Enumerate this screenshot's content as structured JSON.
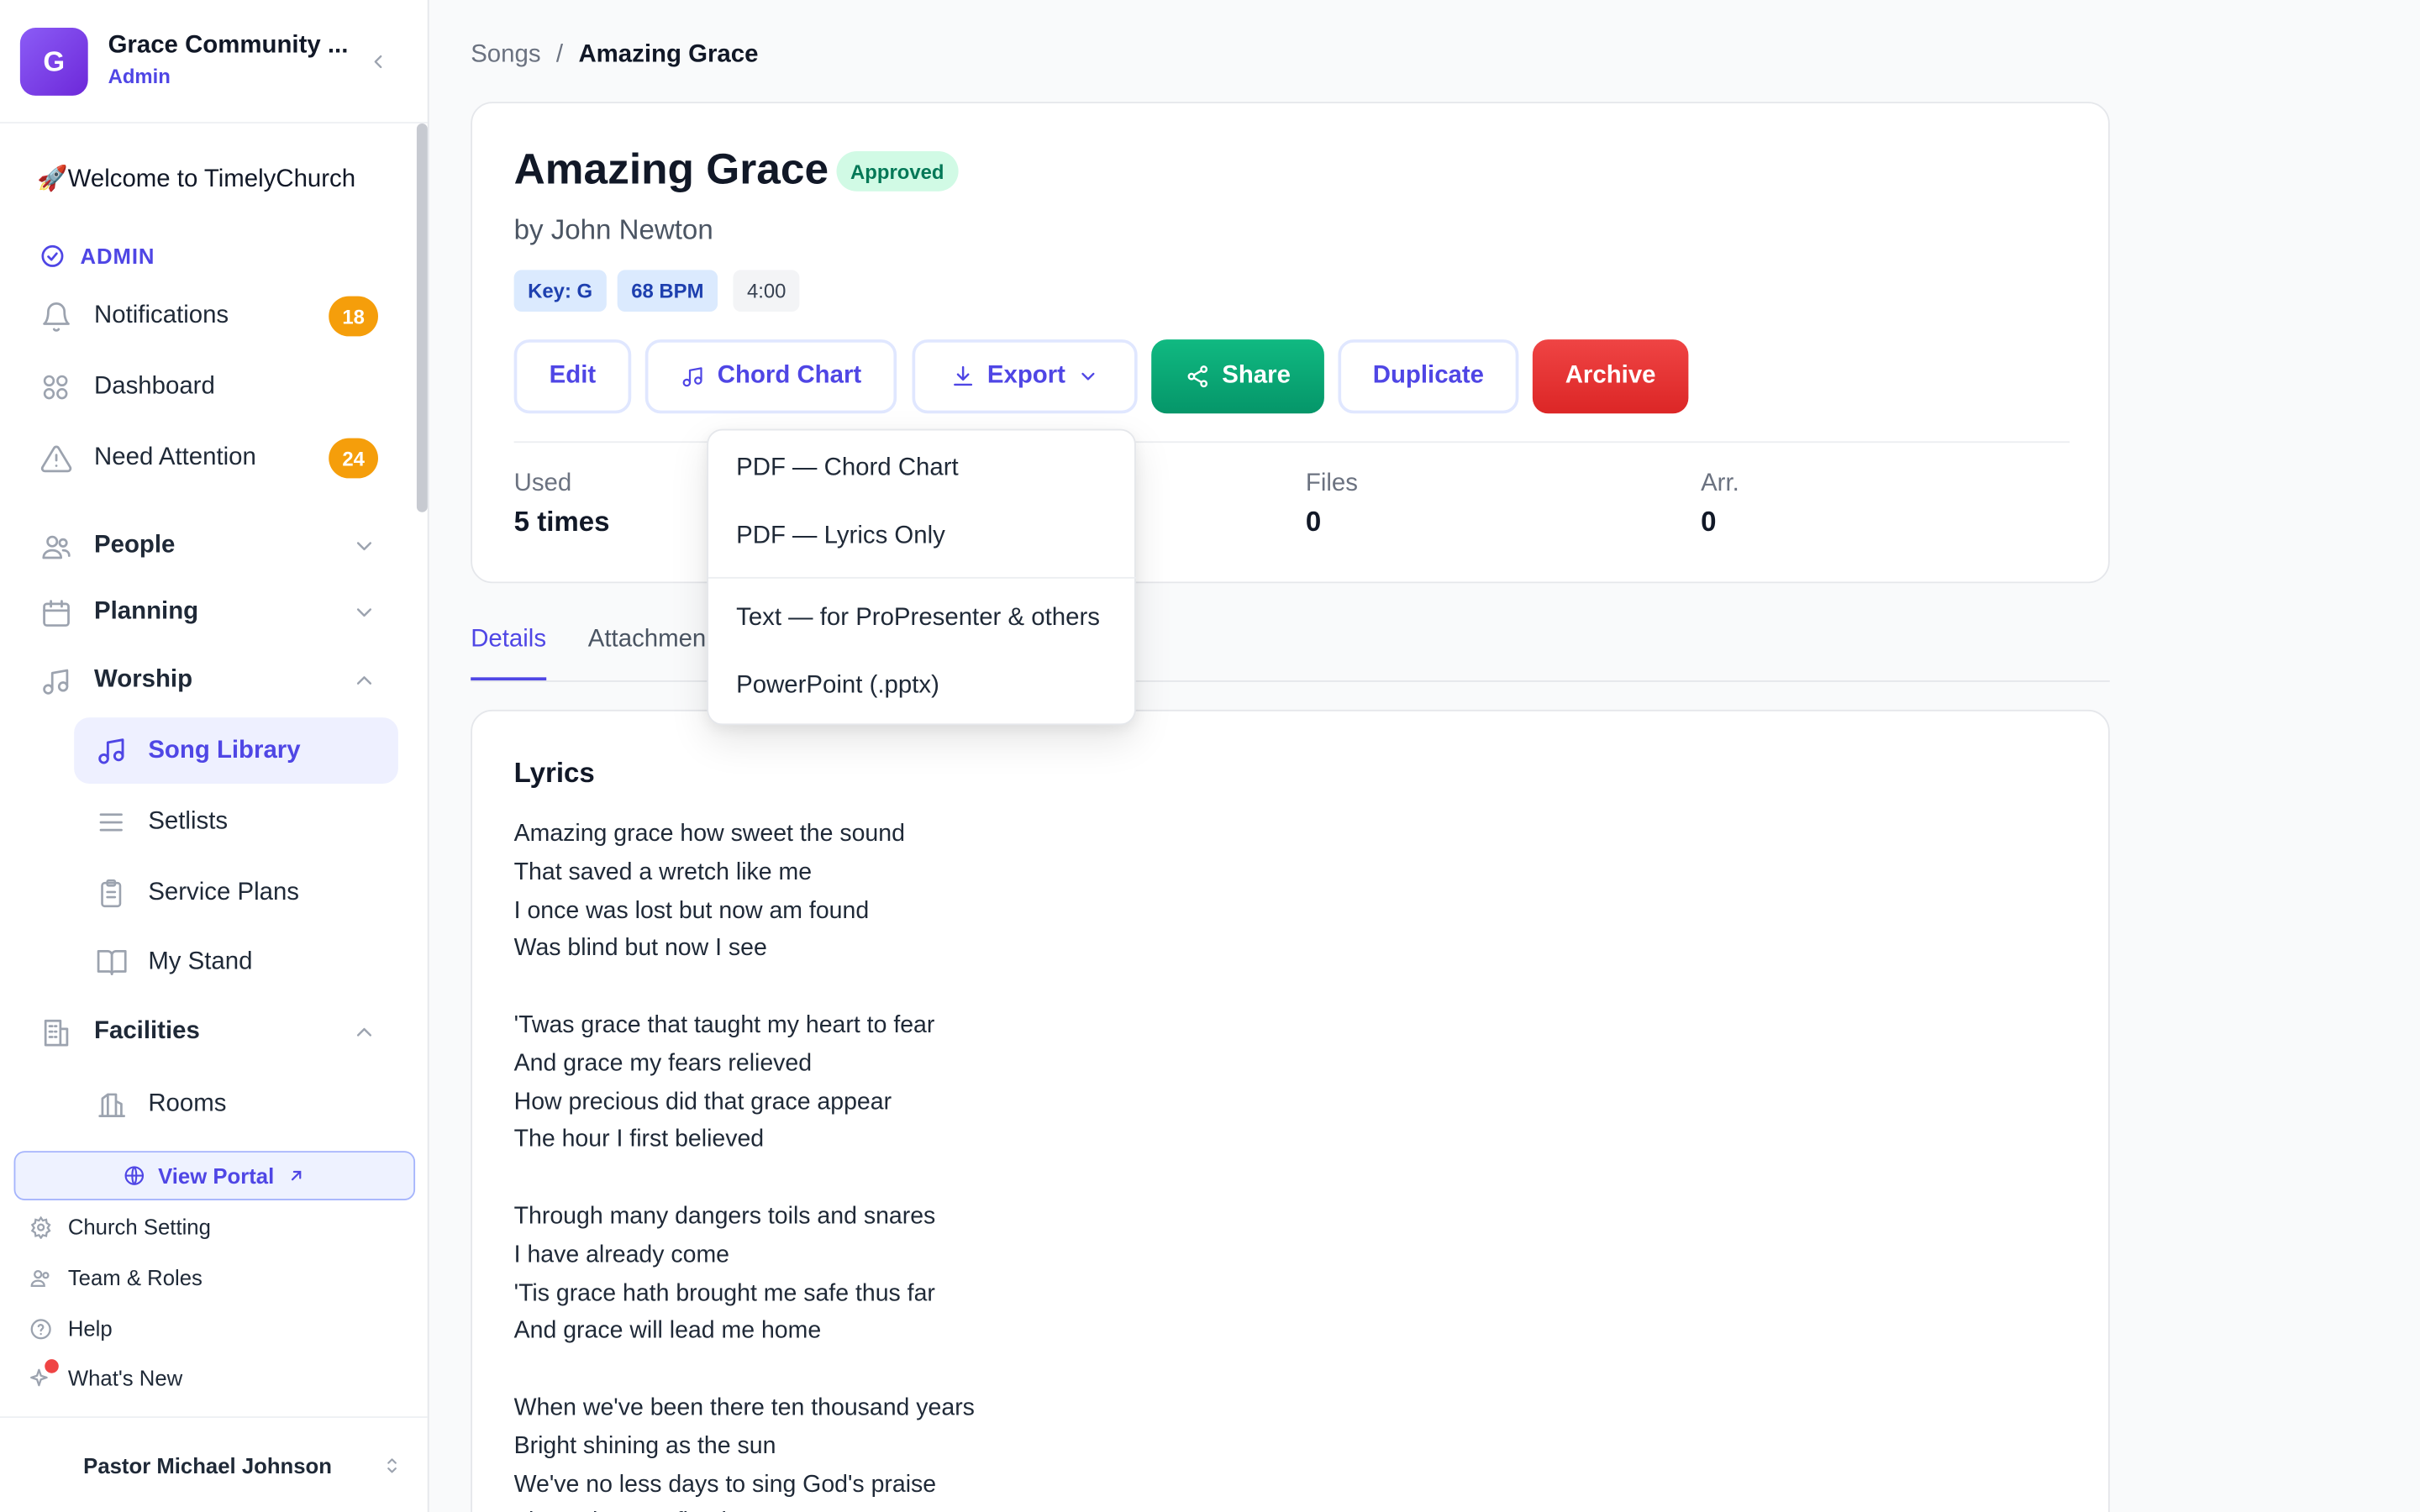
{
  "org": {
    "initial": "G",
    "name": "Grace Community ...",
    "role": "Admin"
  },
  "sidebar": {
    "welcome": "🚀Welcome to TimelyChurch",
    "admin_label": "ADMIN",
    "items": [
      {
        "label": "Notifications",
        "badge": "18"
      },
      {
        "label": "Dashboard"
      },
      {
        "label": "Need Attention",
        "badge": "24"
      },
      {
        "label": "People"
      },
      {
        "label": "Planning"
      },
      {
        "label": "Worship"
      },
      {
        "label": "Song Library"
      },
      {
        "label": "Setlists"
      },
      {
        "label": "Service Plans"
      },
      {
        "label": "My Stand"
      },
      {
        "label": "Facilities"
      },
      {
        "label": "Rooms"
      }
    ],
    "portal": "View Portal",
    "footer": [
      {
        "label": "Church Setting"
      },
      {
        "label": "Team & Roles"
      },
      {
        "label": "Help"
      },
      {
        "label": "What's New"
      }
    ],
    "user": "Pastor Michael Johnson"
  },
  "breadcrumb": {
    "parent": "Songs",
    "sep": "/",
    "current": "Amazing Grace"
  },
  "song": {
    "title": "Amazing Grace",
    "status": "Approved",
    "author": "by John Newton",
    "key": "Key: G",
    "bpm": "68 BPM",
    "length": "4:00"
  },
  "actions": {
    "edit": "Edit",
    "chord_chart": "Chord Chart",
    "export": "Export",
    "share": "Share",
    "duplicate": "Duplicate",
    "archive": "Archive"
  },
  "stats": [
    {
      "label": "Used",
      "value": "5 times"
    },
    {
      "label": "Files",
      "value": "0"
    },
    {
      "label": "Arr.",
      "value": "0"
    }
  ],
  "tabs": [
    "Details",
    "Attachmen"
  ],
  "export_menu": [
    "PDF — Chord Chart",
    "PDF — Lyrics Only",
    "Text — for ProPresenter & others",
    "PowerPoint (.pptx)"
  ],
  "lyrics": {
    "heading": "Lyrics",
    "stanzas": [
      [
        "Amazing grace how sweet the sound",
        "That saved a wretch like me",
        "I once was lost but now am found",
        "Was blind but now I see"
      ],
      [
        "'Twas grace that taught my heart to fear",
        "And grace my fears relieved",
        "How precious did that grace appear",
        "The hour I first believed"
      ],
      [
        "Through many dangers toils and snares",
        "I have already come",
        "'Tis grace hath brought me safe thus far",
        "And grace will lead me home"
      ],
      [
        "When we've been there ten thousand years",
        "Bright shining as the sun",
        "We've no less days to sing God's praise",
        "Than when we first begun"
      ]
    ]
  },
  "colors": {
    "accent": "#4f46e5",
    "badge": "#f59e0b",
    "share": "#059669",
    "archive": "#dc2626",
    "approved": "#047857"
  }
}
